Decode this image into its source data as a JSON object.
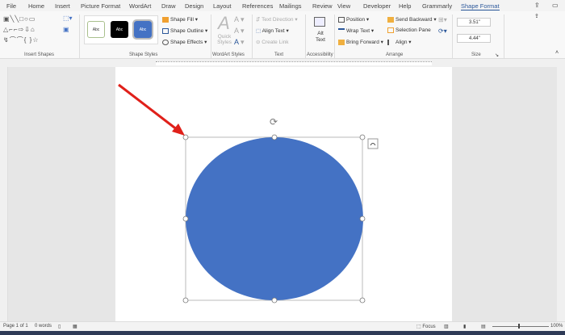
{
  "tabs": [
    "File",
    "Home",
    "Insert",
    "Picture Format",
    "WordArt",
    "Draw",
    "Design",
    "Layout",
    "References",
    "Mailings",
    "Review",
    "View",
    "Developer",
    "Help",
    "Grammarly",
    "Shape Format"
  ],
  "active_tab": "Shape Format",
  "ribbon": {
    "insert_shapes": {
      "label": "Insert Shapes"
    },
    "shape_styles": {
      "label": "Shape Styles",
      "swatches": [
        "Abc",
        "Abc",
        "Abc"
      ],
      "fill": "Shape Fill",
      "outline": "Shape Outline",
      "effects": "Shape Effects"
    },
    "wordart_styles": {
      "label": "WordArt Styles",
      "quick_styles": "Quick Styles"
    },
    "text": {
      "label": "Text",
      "direction": "Text Direction",
      "align": "Align Text",
      "link": "Create Link"
    },
    "accessibility": {
      "label": "Accessibility",
      "alt_text": "Alt Text"
    },
    "arrange": {
      "label": "Arrange",
      "position": "Position",
      "wrap": "Wrap Text",
      "forward": "Bring Forward",
      "backward": "Send Backward",
      "pane": "Selection Pane",
      "align": "Align"
    },
    "size": {
      "label": "Size",
      "height": "3.51\"",
      "width": "4.44\""
    }
  },
  "shape": {
    "fill": "#4472c4"
  },
  "status": {
    "page": "Page 1 of 1",
    "words": "0 words",
    "focus": "Focus",
    "zoom": "100%"
  }
}
